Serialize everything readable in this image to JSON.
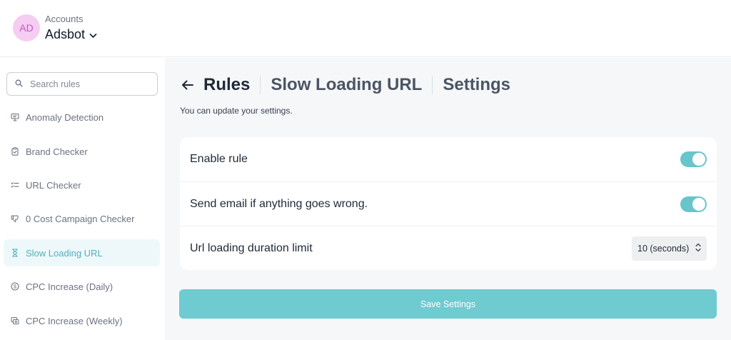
{
  "account": {
    "initials": "AD",
    "caption": "Accounts",
    "name": "Adsbot",
    "avatar_bg": "#f5ccf2",
    "avatar_fg": "#c45ac0"
  },
  "sidebar": {
    "search_placeholder": "Search rules",
    "items": [
      {
        "label": "Anomaly Detection",
        "icon": "presentation-icon",
        "active": false
      },
      {
        "label": "Brand Checker",
        "icon": "clipboard-check-icon",
        "active": false
      },
      {
        "label": "URL Checker",
        "icon": "list-check-icon",
        "active": false
      },
      {
        "label": "0 Cost Campaign Checker",
        "icon": "thumbs-down-icon",
        "active": false
      },
      {
        "label": "Slow Loading URL",
        "icon": "hourglass-icon",
        "active": true
      },
      {
        "label": "CPC Increase (Daily)",
        "icon": "dollar-circle-icon",
        "active": false
      },
      {
        "label": "CPC Increase (Weekly)",
        "icon": "coins-icon",
        "active": false
      }
    ]
  },
  "header": {
    "crumbs": [
      "Rules",
      "Slow Loading URL",
      "Settings"
    ],
    "subtitle": "You can update your settings."
  },
  "settings": {
    "enable_rule": {
      "label": "Enable rule",
      "on": true
    },
    "send_email": {
      "label": "Send email if anything goes wrong.",
      "on": true
    },
    "duration": {
      "label": "Url loading duration limit",
      "value": "10 (seconds)"
    }
  },
  "save_label": "Save Settings",
  "colors": {
    "accent": "#68c5cb",
    "save_button": "#6ecbd0",
    "active_item_bg": "#eef8fa",
    "active_item_text": "#4fb1ba"
  }
}
